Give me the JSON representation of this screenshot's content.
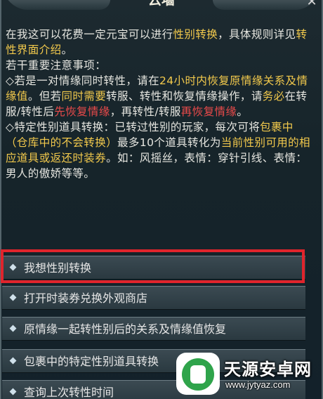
{
  "dialog": {
    "title": "云墙",
    "close_glyph": "✕"
  },
  "description": {
    "p1_a": "在我这可以花费一定元宝可以进行",
    "p1_b": "性别转换",
    "p1_c": "，具体规则详见",
    "p1_d": "转性界面介绍",
    "p1_e": "。",
    "p2": "若干重要注意事项：",
    "p3_a": "◇若是一对情缘同时转性，请在",
    "p3_b": "24小时内恢复原情缘关系及情缘值",
    "p3_c": "。但若",
    "p3_d": "同时需要",
    "p3_e": "转服、转性和恢复情缘操作，请",
    "p3_f": "务必",
    "p3_g": "在转服/转性后",
    "p3_h": "先恢复情缘",
    "p3_i": "，再转性/转服",
    "p3_j": "再恢复情缘",
    "p3_k": "。",
    "p4_a": "◇特定性别道具转换：已转过性别的玩家，每次可将",
    "p4_b": "包裹中（仓库中的不会转换）",
    "p4_c": "最多10个道具转化为",
    "p4_d": "当前性别可用的相应道具或返还时装券",
    "p4_e": "。如：风摇丝，表情：穿针引线、表情：男人的傲娇等等。"
  },
  "options": [
    {
      "label": "我想性别转换"
    },
    {
      "label": "打开时装券兑换外观商店"
    },
    {
      "label": "原情缘一起转性别后的关系及情缘值恢复"
    },
    {
      "label": "包裹中的特定性别道具转换"
    },
    {
      "label": "查询上次转性时间"
    }
  ],
  "watermark": {
    "name": "天源安卓网",
    "url": "www.jytyaz.com"
  }
}
